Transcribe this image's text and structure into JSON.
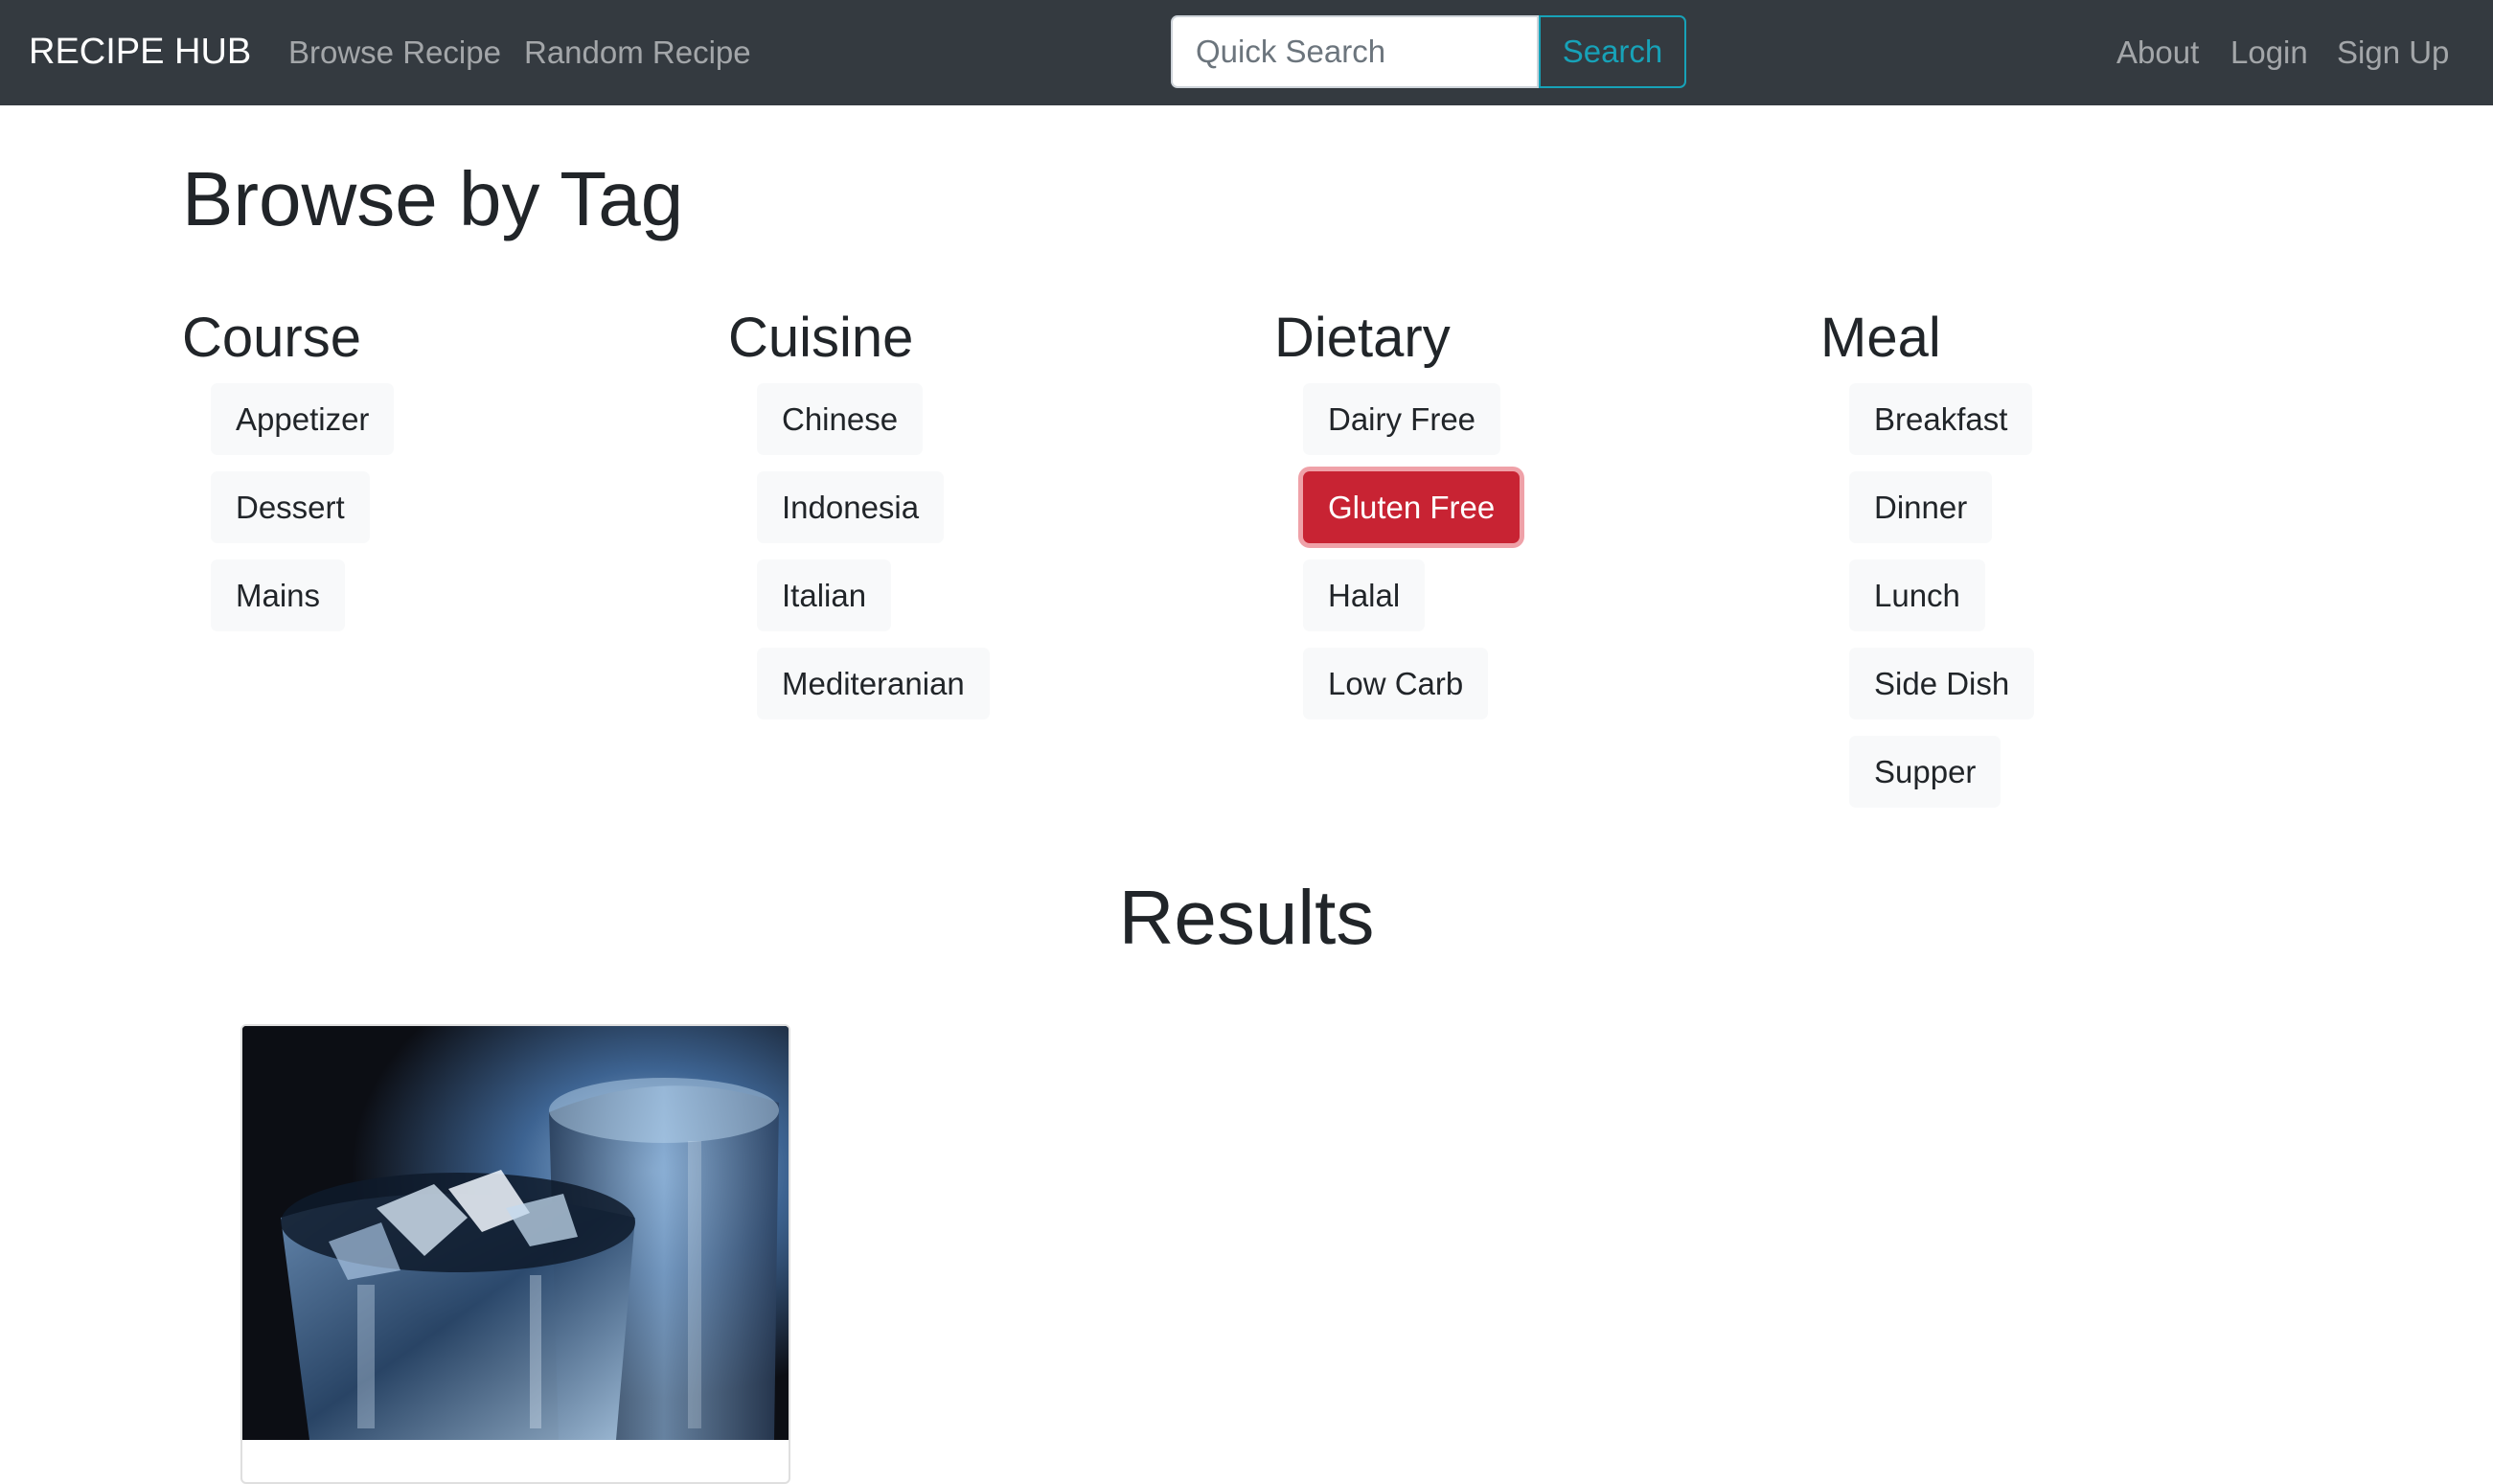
{
  "navbar": {
    "brand": "RECIPE HUB",
    "links": [
      {
        "label": "Browse Recipe"
      },
      {
        "label": "Random Recipe"
      }
    ],
    "search": {
      "placeholder": "Quick Search",
      "value": "",
      "button_label": "Search"
    },
    "right_links": [
      {
        "label": "About"
      },
      {
        "label": "Login"
      },
      {
        "label": "Sign Up"
      }
    ]
  },
  "page_title": "Browse by Tag",
  "tag_groups": [
    {
      "title": "Course",
      "tags": [
        "Appetizer",
        "Dessert",
        "Mains"
      ]
    },
    {
      "title": "Cuisine",
      "tags": [
        "Chinese",
        "Indonesia",
        "Italian",
        "Mediteranian"
      ]
    },
    {
      "title": "Dietary",
      "tags": [
        "Dairy Free",
        "Gluten Free",
        "Halal",
        "Low Carb"
      ]
    },
    {
      "title": "Meal",
      "tags": [
        "Breakfast",
        "Dinner",
        "Lunch",
        "Side Dish",
        "Supper"
      ]
    }
  ],
  "active_tag": "Gluten Free",
  "results_title": "Results",
  "colors": {
    "navbar_bg": "#343a40",
    "search_accent": "#17a2b8",
    "active_tag_bg": "#c82333",
    "tag_bg": "#f8f9fa"
  },
  "icons": {
    "result_card_image": "glass-of-ice-water-photo"
  }
}
